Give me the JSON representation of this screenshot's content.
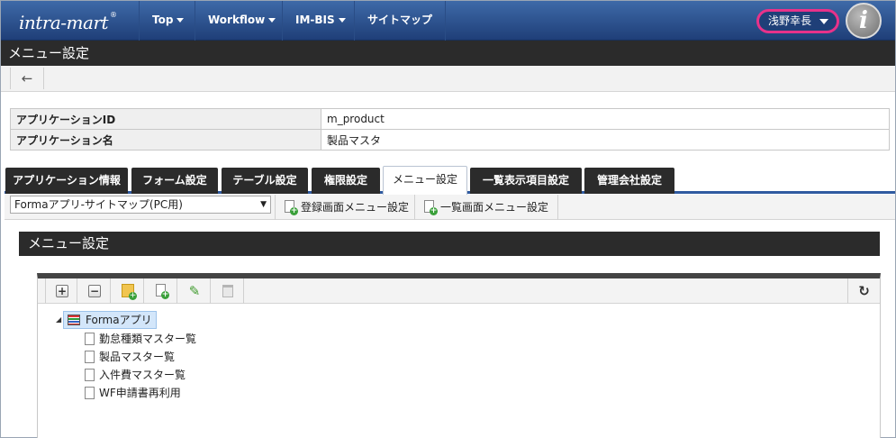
{
  "header": {
    "logo_text": "intra-mart",
    "logo_mark": "®",
    "nav": [
      {
        "label": "Top",
        "dropdown": true
      },
      {
        "label": "Workflow",
        "dropdown": true
      },
      {
        "label": "IM-BIS",
        "dropdown": true
      },
      {
        "label": "サイトマップ",
        "dropdown": false
      }
    ],
    "user_name": "浅野幸長",
    "info_icon_glyph": "i"
  },
  "page_title": "メニュー設定",
  "back_icon": "←",
  "app_info": [
    {
      "label": "アプリケーションID",
      "value": "m_product"
    },
    {
      "label": "アプリケーション名",
      "value": "製品マスタ"
    }
  ],
  "tabs": [
    {
      "label": "アプリケーション情報",
      "active": false
    },
    {
      "label": "フォーム設定",
      "active": false
    },
    {
      "label": "テーブル設定",
      "active": false
    },
    {
      "label": "権限設定",
      "active": false
    },
    {
      "label": "メニュー設定",
      "active": true
    },
    {
      "label": "一覧表示項目設定",
      "active": false
    },
    {
      "label": "管理会社設定",
      "active": false
    }
  ],
  "subbar": {
    "select_value": "Formaアプリ-サイトマップ(PC用)",
    "register_menu_label": "登録画面メニュー設定",
    "list_menu_label": "一覧画面メニュー設定"
  },
  "section_title": "メニュー設定",
  "tree_toolbar": {
    "expand_glyph": "+",
    "collapse_glyph": "−",
    "pencil_glyph": "✎",
    "refresh_glyph": "↻",
    "plus_glyph": "+"
  },
  "tree": {
    "root_label": "Formaアプリ",
    "children": [
      "勤怠種類マスター覧",
      "製品マスター覧",
      "入件費マスター覧",
      "WF申請書再利用"
    ]
  },
  "colors": {
    "nav_bg": "#2a4f8e",
    "highlight": "#e8328a",
    "dark_bar": "#2b2b2b",
    "tab_accent": "#2f5aa0"
  }
}
